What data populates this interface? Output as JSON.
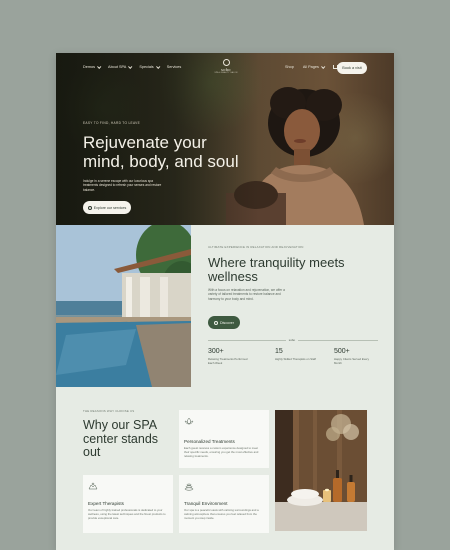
{
  "nav": {
    "menu": [
      {
        "label": "Demos"
      },
      {
        "label": "About SPA"
      },
      {
        "label": "Specials"
      },
      {
        "label": "Services"
      }
    ],
    "logo_name": "sobo",
    "logo_tagline": "SPA & BEAUTY SALON",
    "right": [
      {
        "label": "Shop"
      },
      {
        "label": "All Pages"
      },
      {
        "label": "0"
      }
    ],
    "book_label": "Book a visit"
  },
  "hero": {
    "eyebrow": "EASY TO FIND, HARD TO LEAVE",
    "title": "Rejuvenate your mind, body, and soul",
    "subtitle": "Indulge in a serene escape with our luxurious spa treatments designed to refresh your senses and restore balance.",
    "button": "Explore our services"
  },
  "wellness": {
    "eyebrow": "ULTIMATE EXPERIENCE IN RELAXATION AND REJUVENATION",
    "title": "Where tranquility meets wellness",
    "subtitle": "With a focus on relaxation and rejuvenation, we offer a variety of tailored treatments to restore balance and harmony to your body and mind.",
    "button": "Discover",
    "mini_logo": "sobo",
    "stats": [
      {
        "num": "300+",
        "label": "Relaxing Treatments Performed Each Week"
      },
      {
        "num": "15",
        "label": "Highly Skilled Therapists on Staff"
      },
      {
        "num": "500+",
        "label": "Happy Clients Served Every Month"
      }
    ]
  },
  "why": {
    "eyebrow": "THE REASONS WHY CHOOSE US",
    "title": "Why our SPA center stands out",
    "cards": [
      {
        "title": "Personalized Treatments",
        "desc": "Each guest receives a custom experience designed to meet their specific needs, ensuring you get the most effective and relaxing treatments.",
        "icon": "lotus-icon"
      },
      {
        "title": "Expert Therapists",
        "desc": "Our team of highly trained professionals is dedicated to your wellness, using the latest techniques and the finest products to provide exceptional care.",
        "icon": "hands-icon"
      },
      {
        "title": "Tranquil Environment",
        "desc": "Our spa is a peaceful oasis with calming surroundings and a calming atmosphere that ensures you feel relaxed from the moment you step inside.",
        "icon": "stones-icon"
      }
    ]
  }
}
